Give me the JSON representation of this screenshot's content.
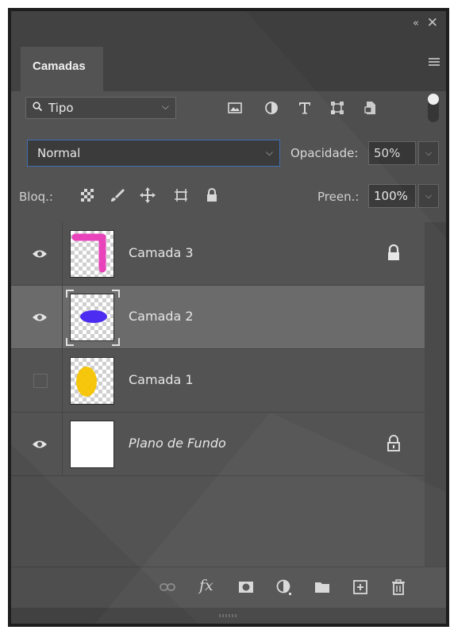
{
  "panel": {
    "tab_label": "Camadas"
  },
  "filter": {
    "kind_label": "Tipo"
  },
  "blend": {
    "mode": "Normal",
    "opacity_label": "Opacidade:",
    "opacity_value": "50%"
  },
  "lock": {
    "label": "Bloq.:",
    "fill_label": "Preen.:",
    "fill_value": "100%"
  },
  "layers": [
    {
      "name": "Camada 3",
      "visible": true,
      "locked": true,
      "selected": false
    },
    {
      "name": "Camada 2",
      "visible": true,
      "locked": false,
      "selected": true
    },
    {
      "name": "Camada 1",
      "visible": false,
      "locked": false,
      "selected": false
    },
    {
      "name": "Plano de Fundo",
      "visible": true,
      "locked": true,
      "selected": false
    }
  ],
  "icons": {
    "collapse": "«",
    "close": "✕",
    "chevron": "⌵"
  },
  "colors": {
    "panel_bg": "#535353",
    "selected_row": "#6b6b6b",
    "accent_border": "#3f6fb0",
    "layer3_paint": "#e83ab8",
    "layer2_paint": "#4b2cf0",
    "layer1_paint": "#f5c400"
  }
}
